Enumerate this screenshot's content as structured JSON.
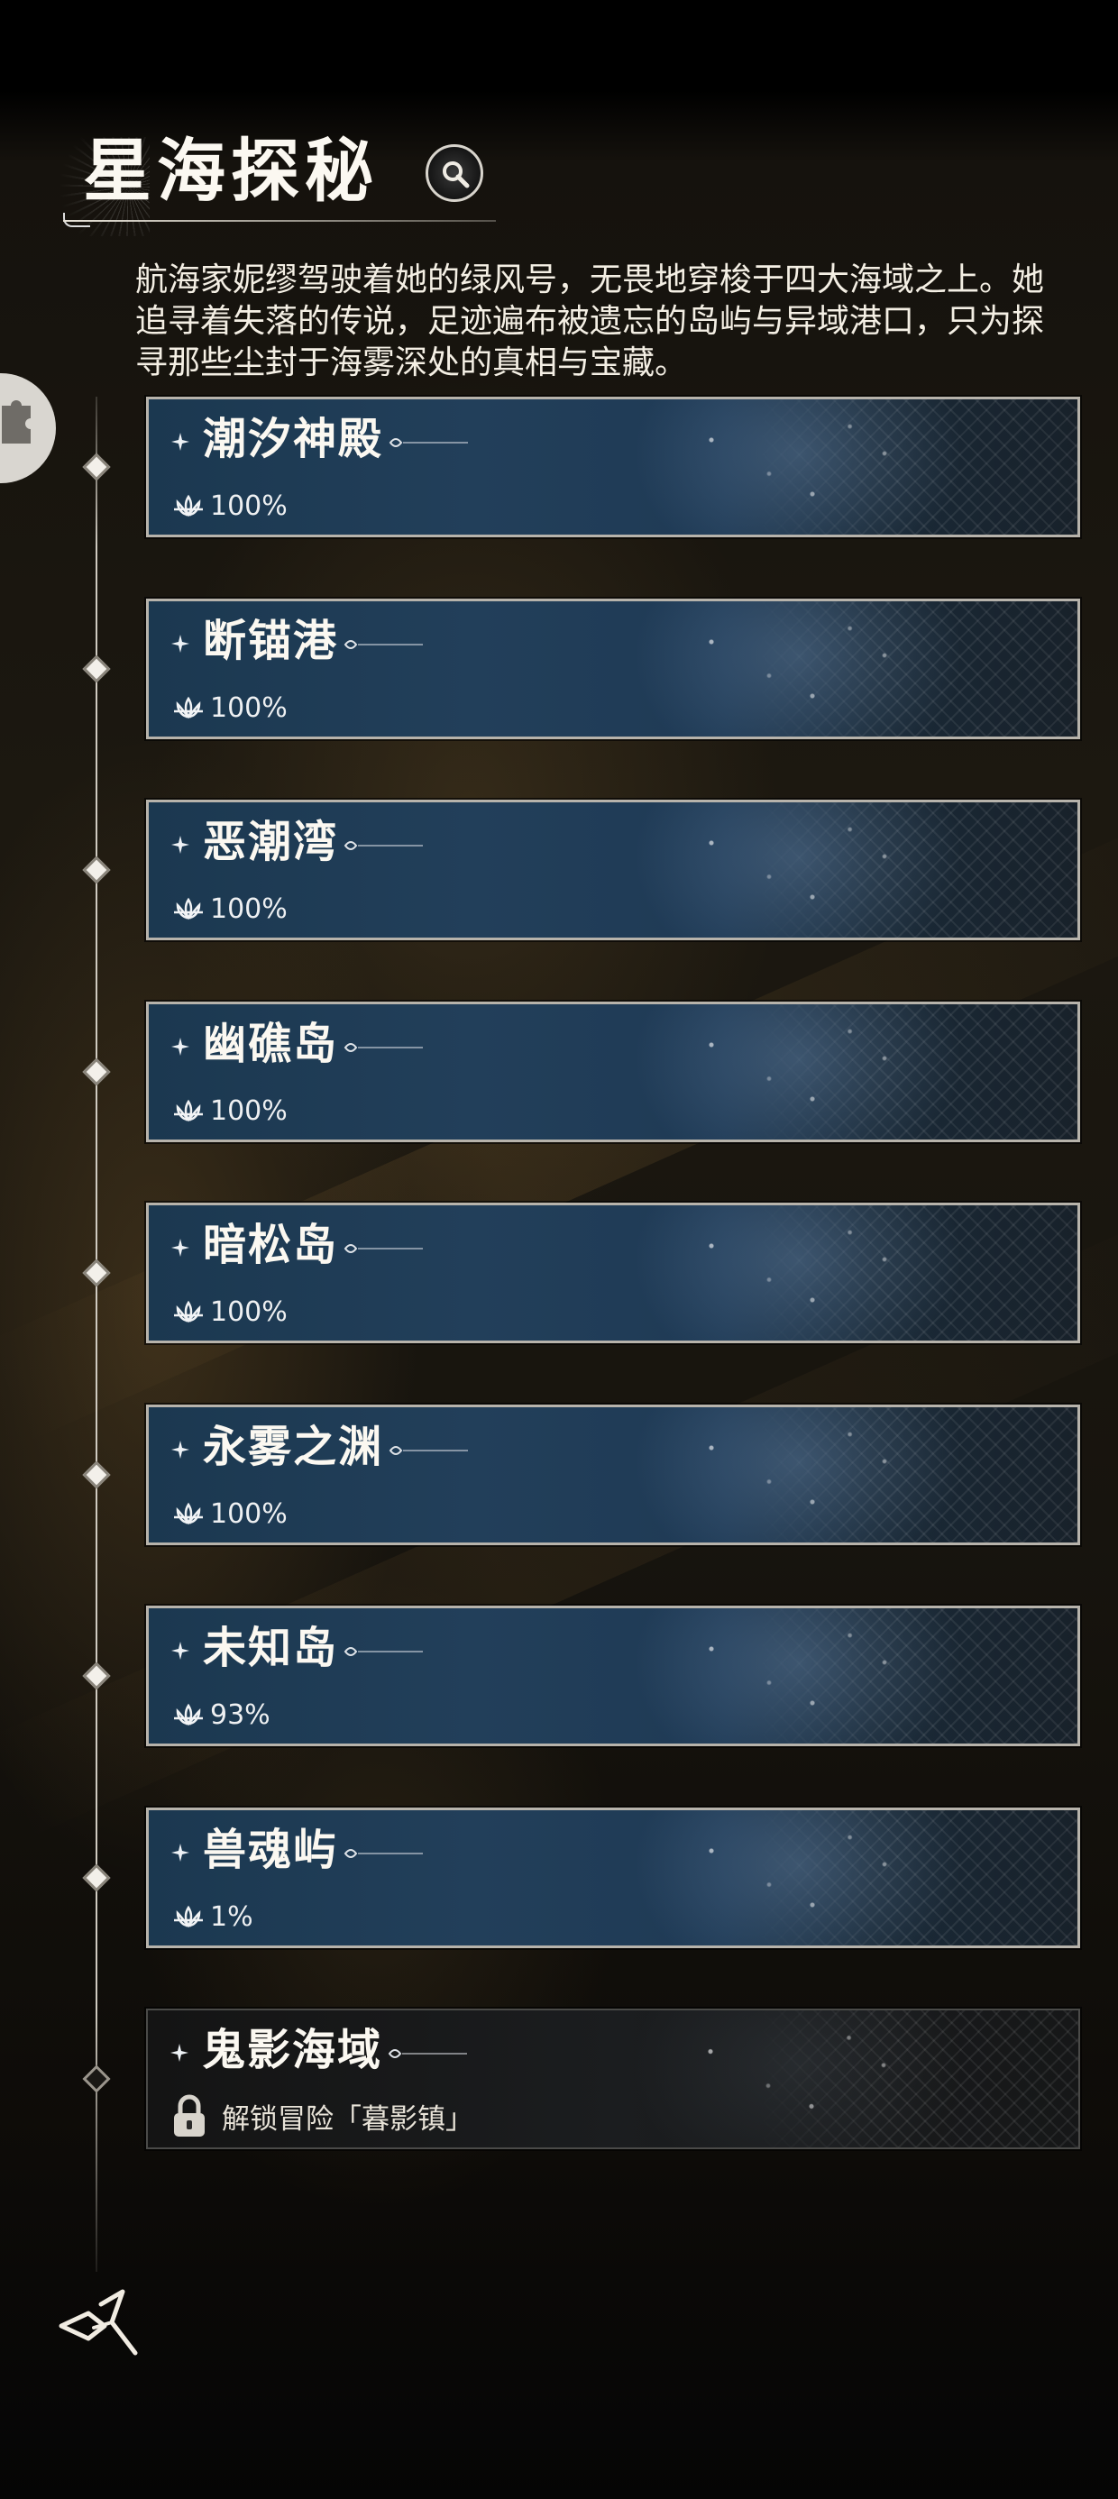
{
  "header": {
    "title": "星海探秘"
  },
  "description": "航海家妮缪驾驶着她的绿风号，无畏地穿梭于四大海域之上。她追寻着失落的传说，足迹遍布被遗忘的岛屿与异域港口，只为探寻那些尘封于海雾深处的真相与宝藏。",
  "regions": [
    {
      "name": "潮汐神殿",
      "progress": "100%",
      "status": "unlocked"
    },
    {
      "name": "断锚港",
      "progress": "100%",
      "status": "unlocked"
    },
    {
      "name": "恶潮湾",
      "progress": "100%",
      "status": "unlocked"
    },
    {
      "name": "幽礁岛",
      "progress": "100%",
      "status": "unlocked"
    },
    {
      "name": "暗松岛",
      "progress": "100%",
      "status": "unlocked"
    },
    {
      "name": "永雾之渊",
      "progress": "100%",
      "status": "unlocked"
    },
    {
      "name": "未知岛",
      "progress": "93%",
      "status": "unlocked"
    },
    {
      "name": "兽魂屿",
      "progress": "1%",
      "status": "unlocked"
    },
    {
      "name": "鬼影海域",
      "unlock_hint": "解锁冒险「暮影镇」",
      "status": "locked"
    }
  ],
  "icons": {
    "search": "magnifier-icon",
    "side": "puzzle-icon",
    "progress": "lotus-icon",
    "lock": "lock-icon",
    "back": "back-arrow-icon"
  },
  "colors": {
    "card_blue": "#1f3a55",
    "card_border": "#b7b3ab",
    "text": "#fbf8f1",
    "locked_card": "#1b1d1f"
  }
}
